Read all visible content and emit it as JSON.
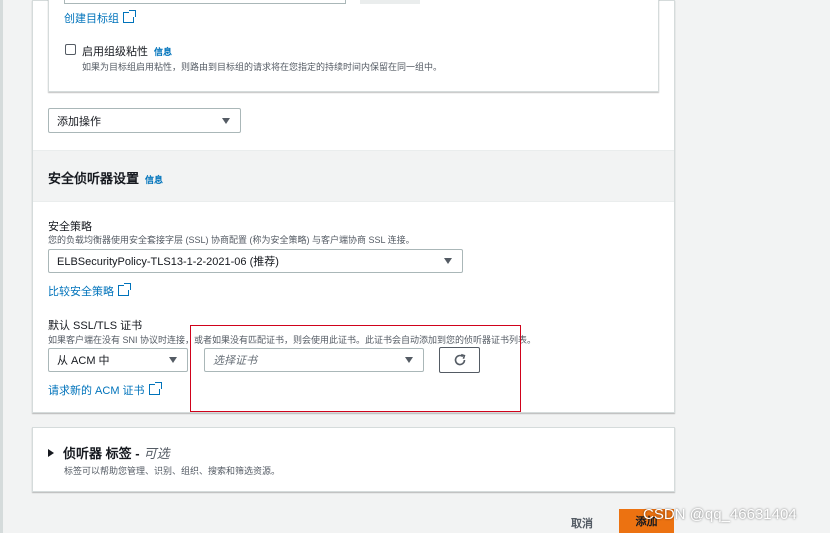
{
  "target_group": {
    "create_link": "创建目标组",
    "stickiness_label": "启用组级粘性",
    "stickiness_info": "信息",
    "stickiness_desc": "如果为目标组启用粘性，则路由到目标组的请求将在您指定的持续时间内保留在同一组中。"
  },
  "add_action": {
    "label": "添加操作"
  },
  "secure_listener": {
    "title": "安全侦听器设置",
    "info": "信息",
    "policy_label": "安全策略",
    "policy_desc": "您的负载均衡器使用安全套接字层 (SSL) 协商配置 (称为安全策略) 与客户端协商 SSL 连接。",
    "policy_value": "ELBSecurityPolicy-TLS13-1-2-2021-06 (推荐)",
    "compare_link": "比较安全策略",
    "cert_label": "默认 SSL/TLS 证书",
    "cert_desc": "如果客户端在没有 SNI 协议时连接，或者如果没有匹配证书，则会使用此证书。此证书会自动添加到您的侦听器证书列表。",
    "cert_source": "从 ACM 中",
    "cert_placeholder": "选择证书",
    "request_link": "请求新的 ACM 证书"
  },
  "tags": {
    "title": "侦听器 标签 -",
    "optional": "可选",
    "desc": "标签可以帮助您管理、识别、组织、搜索和筛选资源。"
  },
  "footer": {
    "cancel": "取消",
    "add": "添加"
  },
  "watermark": "CSDN @qq_46631404",
  "colors": {
    "link": "#0073bb",
    "primary": "#ec7211",
    "highlight": "#d0021b"
  }
}
